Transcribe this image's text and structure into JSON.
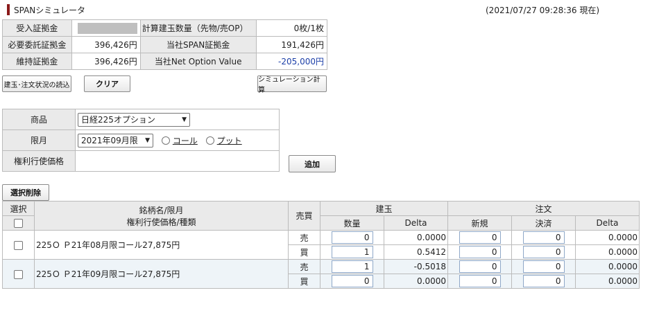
{
  "header": {
    "title": "SPANシミュレータ",
    "timestamp": "(2021/07/27 09:28:36 現在)"
  },
  "summary": {
    "row1": {
      "label1": "受入証拠金",
      "value1": "",
      "label2": "計算建玉数量（先物/売OP）",
      "value2": "0枚/1枚"
    },
    "row2": {
      "label1": "必要委託証拠金",
      "value1": "396,426円",
      "label2": "当社SPAN証拠金",
      "value2": "191,426円"
    },
    "row3": {
      "label1": "維持証拠金",
      "value1": "396,426円",
      "label2": "当社Net Option Value",
      "value2": "-205,000円"
    }
  },
  "buttons": {
    "load": "建玉･注文状況の読込",
    "clear": "クリア",
    "simulate": "シミュレーション計算",
    "add": "追加",
    "delete_selected": "選択削除"
  },
  "form": {
    "product_label": "商品",
    "product_value": "日経225オプション",
    "month_label": "限月",
    "month_value": "2021年09月限",
    "call_label": "コール",
    "put_label": "プット",
    "strike_label": "権利行使価格",
    "strike_value": ""
  },
  "grid": {
    "headers": {
      "select": "選択",
      "name_top": "銘柄名/限月",
      "name_bottom": "権利行使価格/種類",
      "side": "売買",
      "position": "建玉",
      "order": "注文",
      "qty": "数量",
      "delta": "Delta",
      "new": "新規",
      "settle": "決済",
      "order_delta": "Delta"
    },
    "rows": [
      {
        "name": "225Ｏ Ｐ21年08月限コール27,875円",
        "sell": {
          "side": "売",
          "qty": "0",
          "delta": "0.0000",
          "new": "0",
          "settle": "0",
          "order_delta": "0.0000"
        },
        "buy": {
          "side": "買",
          "qty": "1",
          "delta": "0.5412",
          "new": "0",
          "settle": "0",
          "order_delta": "0.0000"
        }
      },
      {
        "name": "225Ｏ Ｐ21年09月限コール27,875円",
        "sell": {
          "side": "売",
          "qty": "1",
          "delta": "-0.5018",
          "new": "0",
          "settle": "0",
          "order_delta": "0.0000"
        },
        "buy": {
          "side": "買",
          "qty": "0",
          "delta": "0.0000",
          "new": "0",
          "settle": "0",
          "order_delta": "0.0000"
        }
      }
    ]
  },
  "colors": {
    "title_mark": "#8b1a1a",
    "negative_value": "#1c3fa8",
    "alt_row": "#eef4f8"
  }
}
